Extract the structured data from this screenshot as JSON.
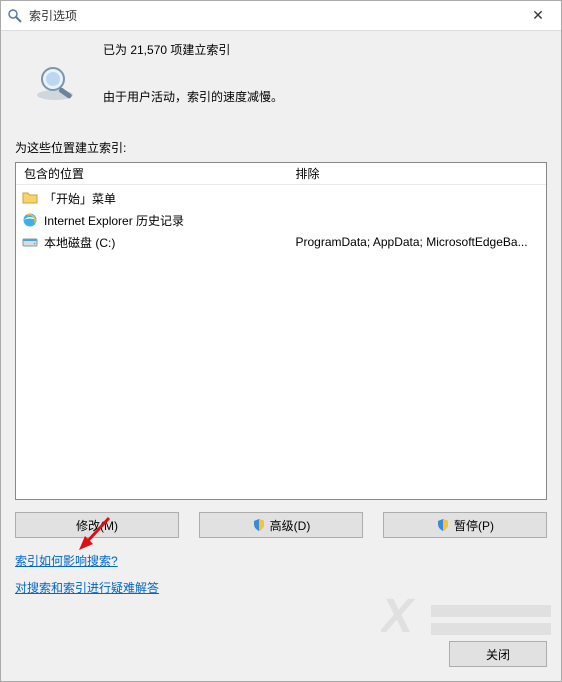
{
  "titlebar": {
    "title": "索引选项",
    "close_symbol": "✕"
  },
  "status": {
    "line1": "已为 21,570 项建立索引",
    "line2": "由于用户活动，索引的速度减慢。"
  },
  "section_label": "为这些位置建立索引:",
  "columns": {
    "included_header": "包含的位置",
    "excluded_header": "排除"
  },
  "included": [
    {
      "icon": "folder-icon",
      "label": "「开始」菜单",
      "exclude": ""
    },
    {
      "icon": "ie-icon",
      "label": "Internet Explorer 历史记录",
      "exclude": ""
    },
    {
      "icon": "drive-icon",
      "label": "本地磁盘 (C:)",
      "exclude": "ProgramData; AppData; MicrosoftEdgeBa..."
    }
  ],
  "buttons": {
    "modify": "修改(M)",
    "advanced": "高级(D)",
    "pause": "暂停(P)"
  },
  "links": {
    "howto": "索引如何影响搜索?",
    "troubleshoot": "对搜索和索引进行疑难解答"
  },
  "footer": {
    "close": "关闭"
  }
}
